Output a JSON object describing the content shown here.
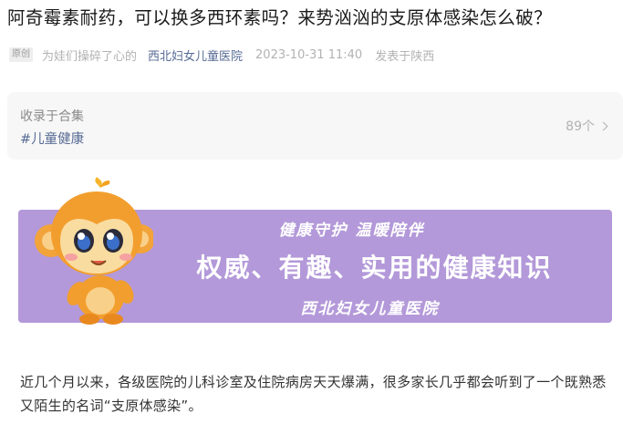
{
  "article": {
    "title": "阿奇霉素耐药，可以换多西环素吗？来势汹汹的支原体感染怎么破？",
    "original_tag": "原创",
    "author": "为娃们操碎了心的",
    "account": "西北妇女儿童医院",
    "datetime": "2023-10-31 11:40",
    "location": "发表于陕西"
  },
  "collection": {
    "label": "收录于合集",
    "tag": "#儿童健康",
    "count": "89个"
  },
  "banner": {
    "subtitle": "健康守护 温暖陪伴",
    "headline": "权威、有趣、实用的健康知识",
    "hospital": "西北妇女儿童医院",
    "background_color": "#b399d9",
    "mascot_icon": "orange-monkey-mascot"
  },
  "body": {
    "paragraph_1": "近几个月以来，各级医院的儿科诊室及住院病房天天爆满，很多家长几乎都会听到了一个既熟悉又陌生的名词“支原体感染”。"
  },
  "colors": {
    "link": "#576b95",
    "meta_gray": "#b2b2b2",
    "text": "#333333"
  }
}
